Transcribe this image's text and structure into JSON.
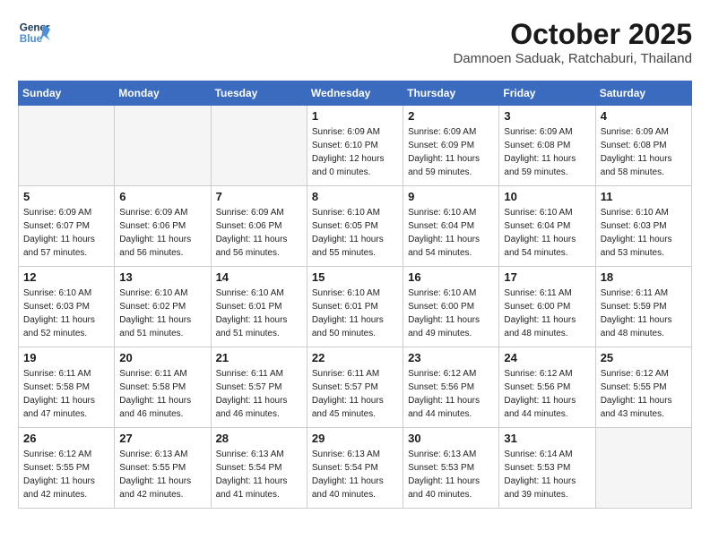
{
  "header": {
    "logo_line1": "General",
    "logo_line2": "Blue",
    "month": "October 2025",
    "location": "Damnoen Saduak, Ratchaburi, Thailand"
  },
  "weekdays": [
    "Sunday",
    "Monday",
    "Tuesday",
    "Wednesday",
    "Thursday",
    "Friday",
    "Saturday"
  ],
  "weeks": [
    [
      {
        "day": "",
        "info": ""
      },
      {
        "day": "",
        "info": ""
      },
      {
        "day": "",
        "info": ""
      },
      {
        "day": "1",
        "info": "Sunrise: 6:09 AM\nSunset: 6:10 PM\nDaylight: 12 hours\nand 0 minutes."
      },
      {
        "day": "2",
        "info": "Sunrise: 6:09 AM\nSunset: 6:09 PM\nDaylight: 11 hours\nand 59 minutes."
      },
      {
        "day": "3",
        "info": "Sunrise: 6:09 AM\nSunset: 6:08 PM\nDaylight: 11 hours\nand 59 minutes."
      },
      {
        "day": "4",
        "info": "Sunrise: 6:09 AM\nSunset: 6:08 PM\nDaylight: 11 hours\nand 58 minutes."
      }
    ],
    [
      {
        "day": "5",
        "info": "Sunrise: 6:09 AM\nSunset: 6:07 PM\nDaylight: 11 hours\nand 57 minutes."
      },
      {
        "day": "6",
        "info": "Sunrise: 6:09 AM\nSunset: 6:06 PM\nDaylight: 11 hours\nand 56 minutes."
      },
      {
        "day": "7",
        "info": "Sunrise: 6:09 AM\nSunset: 6:06 PM\nDaylight: 11 hours\nand 56 minutes."
      },
      {
        "day": "8",
        "info": "Sunrise: 6:10 AM\nSunset: 6:05 PM\nDaylight: 11 hours\nand 55 minutes."
      },
      {
        "day": "9",
        "info": "Sunrise: 6:10 AM\nSunset: 6:04 PM\nDaylight: 11 hours\nand 54 minutes."
      },
      {
        "day": "10",
        "info": "Sunrise: 6:10 AM\nSunset: 6:04 PM\nDaylight: 11 hours\nand 54 minutes."
      },
      {
        "day": "11",
        "info": "Sunrise: 6:10 AM\nSunset: 6:03 PM\nDaylight: 11 hours\nand 53 minutes."
      }
    ],
    [
      {
        "day": "12",
        "info": "Sunrise: 6:10 AM\nSunset: 6:03 PM\nDaylight: 11 hours\nand 52 minutes."
      },
      {
        "day": "13",
        "info": "Sunrise: 6:10 AM\nSunset: 6:02 PM\nDaylight: 11 hours\nand 51 minutes."
      },
      {
        "day": "14",
        "info": "Sunrise: 6:10 AM\nSunset: 6:01 PM\nDaylight: 11 hours\nand 51 minutes."
      },
      {
        "day": "15",
        "info": "Sunrise: 6:10 AM\nSunset: 6:01 PM\nDaylight: 11 hours\nand 50 minutes."
      },
      {
        "day": "16",
        "info": "Sunrise: 6:10 AM\nSunset: 6:00 PM\nDaylight: 11 hours\nand 49 minutes."
      },
      {
        "day": "17",
        "info": "Sunrise: 6:11 AM\nSunset: 6:00 PM\nDaylight: 11 hours\nand 48 minutes."
      },
      {
        "day": "18",
        "info": "Sunrise: 6:11 AM\nSunset: 5:59 PM\nDaylight: 11 hours\nand 48 minutes."
      }
    ],
    [
      {
        "day": "19",
        "info": "Sunrise: 6:11 AM\nSunset: 5:58 PM\nDaylight: 11 hours\nand 47 minutes."
      },
      {
        "day": "20",
        "info": "Sunrise: 6:11 AM\nSunset: 5:58 PM\nDaylight: 11 hours\nand 46 minutes."
      },
      {
        "day": "21",
        "info": "Sunrise: 6:11 AM\nSunset: 5:57 PM\nDaylight: 11 hours\nand 46 minutes."
      },
      {
        "day": "22",
        "info": "Sunrise: 6:11 AM\nSunset: 5:57 PM\nDaylight: 11 hours\nand 45 minutes."
      },
      {
        "day": "23",
        "info": "Sunrise: 6:12 AM\nSunset: 5:56 PM\nDaylight: 11 hours\nand 44 minutes."
      },
      {
        "day": "24",
        "info": "Sunrise: 6:12 AM\nSunset: 5:56 PM\nDaylight: 11 hours\nand 44 minutes."
      },
      {
        "day": "25",
        "info": "Sunrise: 6:12 AM\nSunset: 5:55 PM\nDaylight: 11 hours\nand 43 minutes."
      }
    ],
    [
      {
        "day": "26",
        "info": "Sunrise: 6:12 AM\nSunset: 5:55 PM\nDaylight: 11 hours\nand 42 minutes."
      },
      {
        "day": "27",
        "info": "Sunrise: 6:13 AM\nSunset: 5:55 PM\nDaylight: 11 hours\nand 42 minutes."
      },
      {
        "day": "28",
        "info": "Sunrise: 6:13 AM\nSunset: 5:54 PM\nDaylight: 11 hours\nand 41 minutes."
      },
      {
        "day": "29",
        "info": "Sunrise: 6:13 AM\nSunset: 5:54 PM\nDaylight: 11 hours\nand 40 minutes."
      },
      {
        "day": "30",
        "info": "Sunrise: 6:13 AM\nSunset: 5:53 PM\nDaylight: 11 hours\nand 40 minutes."
      },
      {
        "day": "31",
        "info": "Sunrise: 6:14 AM\nSunset: 5:53 PM\nDaylight: 11 hours\nand 39 minutes."
      },
      {
        "day": "",
        "info": ""
      }
    ]
  ]
}
